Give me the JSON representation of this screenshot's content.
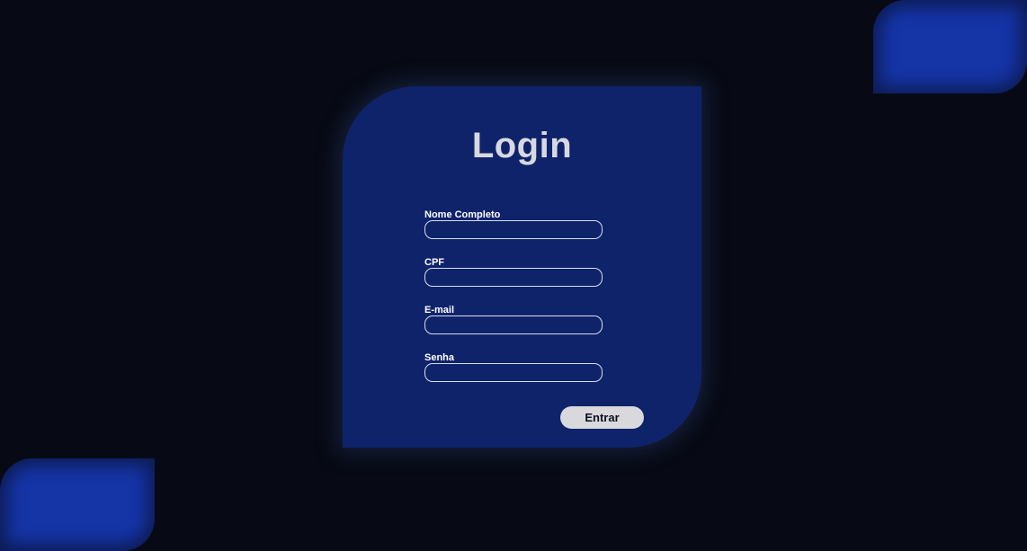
{
  "form": {
    "title": "Login",
    "fields": [
      {
        "label": "Nome Completo",
        "value": "",
        "placeholder": ""
      },
      {
        "label": "CPF",
        "value": "",
        "placeholder": ""
      },
      {
        "label": "E-mail",
        "value": "",
        "placeholder": ""
      },
      {
        "label": "Senha",
        "value": "",
        "placeholder": ""
      }
    ],
    "submit_label": "Entrar"
  },
  "colors": {
    "background": "#070a14",
    "card": "#0f236b",
    "accent_shape": "#1534a6",
    "button": "#d9d9dd"
  }
}
